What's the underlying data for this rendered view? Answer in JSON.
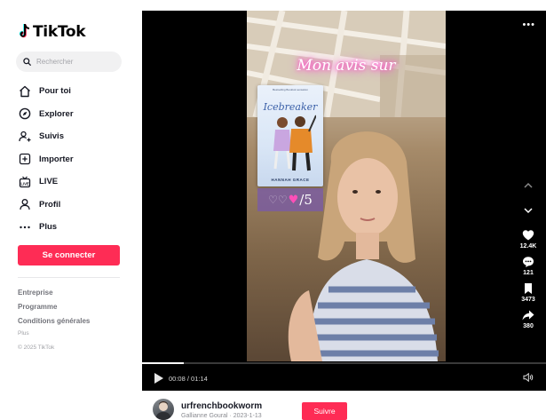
{
  "app": {
    "logo_text": "TikTok",
    "accent": "#fe2c55"
  },
  "search": {
    "placeholder": "Rechercher"
  },
  "sidebar": {
    "items": [
      {
        "label": "Pour toi",
        "icon": "home-icon"
      },
      {
        "label": "Explorer",
        "icon": "compass-icon"
      },
      {
        "label": "Suivis",
        "icon": "follow-user-icon"
      },
      {
        "label": "Importer",
        "icon": "upload-plus-icon"
      },
      {
        "label": "LIVE",
        "icon": "live-tv-icon"
      },
      {
        "label": "Profil",
        "icon": "person-icon"
      },
      {
        "label": "Plus",
        "icon": "more-dots-icon"
      }
    ],
    "login_label": "Se connecter",
    "footer": {
      "links": [
        "Entreprise",
        "Programme",
        "Conditions générales"
      ],
      "more": "Plus",
      "copyright": "© 2025 TikTok"
    }
  },
  "video": {
    "overlay_title": "Mon avis sur",
    "book": {
      "tagline": "Bestselling Booktok sensation",
      "title": "Icebreaker",
      "author": "HANNAH GRACE"
    },
    "rating": {
      "score": "/5",
      "full_hearts": 1
    },
    "progress_fraction": 0.104,
    "time_current": "00:08",
    "time_total": "01:14",
    "time_display": "00:08 / 01:14"
  },
  "actions": {
    "like_count": "12.4K",
    "comment_count": "121",
    "save_count": "3473",
    "share_count": "380"
  },
  "author": {
    "username": "urfrenchbookworm",
    "subtitle": "Gallianne Goural · 2023-1-13",
    "follow_label": "Suivre"
  }
}
